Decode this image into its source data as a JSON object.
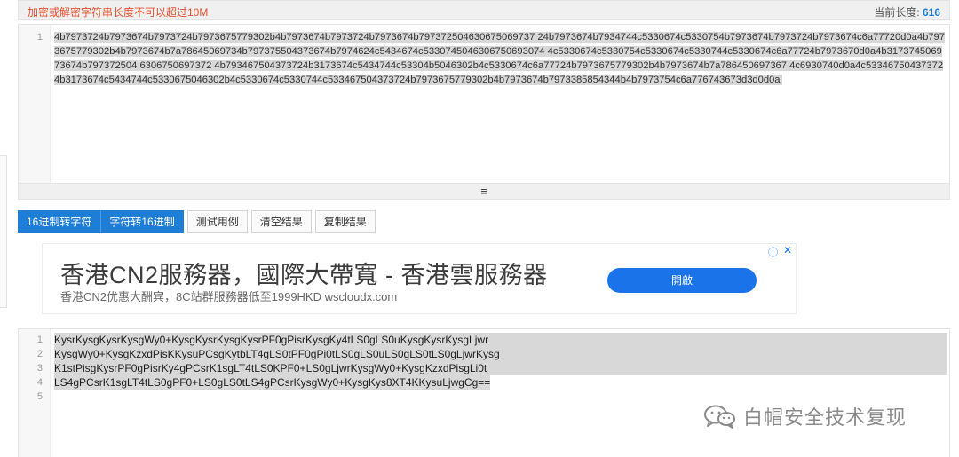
{
  "header": {
    "warning": "加密或解密字符串长度不可以超过10M",
    "length_label": "当前长度:",
    "length_value": "616"
  },
  "input_editor": {
    "line_numbers": [
      "1"
    ],
    "text": "4b7973724b7973674b7973724b7973675779302b4b7973674b7973724b7973674b797372504630675069737 24b7973674b7934744c5330674c5330754b7973674b7973724b7973674c6a77720d0a4b7973675779302b4b7973674b7a78645069734b797375504373674b7974624c5434674c5330745046306750693074 4c5330674c5330754c5330674c5330744c5330674c6a77724b7973670d0a4b317374506973674b797372504 6306750697372 4b793467504373724b3173674c5434744c53304b5046302b4c5330674c6a77724b7973675779302b4b7973674b7a786450697367 4c6930740d0a4c533467504373724b3173674c5434744c5330675046302b4c5330674c5330744c533467504373724b7973675779302b4b7973674b7973385854344b4b7973754c6a776743673d3d0d0a"
  },
  "resize_handle": "≡",
  "toolbar": {
    "hex_to_str": "16进制转字符",
    "str_to_hex": "字符转16进制",
    "test_case": "测试用例",
    "clear": "清空结果",
    "copy": "复制结果"
  },
  "ad": {
    "title": "香港CN2服務器，國際大帶寬 - 香港雲服務器",
    "subtitle": "香港CN2优惠大酬宾，8C站群服務器低至1999HKD wscloudx.com",
    "cta": "開啟",
    "info": "ⓘ",
    "close": "✕"
  },
  "output_editor": {
    "line_numbers": [
      "1",
      "2",
      "3",
      "4",
      "5"
    ],
    "lines": [
      "KysrKysgKysrKysgWy0+KysgKysrKysgKysrPF0gPisrKysgKy4tLS0gLS0uKysgKysrKysgLjwr",
      "KysgWy0+KysgKzxdPisKKysuPCsgKytbLT4gLS0tPF0gPi0tLS0gLS0uLS0gLS0tLS0gLjwrKysg",
      "K1stPisgKysrPF0gPisrKy4gPCsrK1sgLT4tLS0KPF0+LS0gLjwrKysgWy0+KysgKzxdPisgLi0t",
      "LS4gPCsrK1sgLT4tLS0gPF0+LS0gLS0tLS4gPCsrKysgWy0+KysgKys8XT4KKysuLjwgCg==",
      ""
    ]
  },
  "watermark": {
    "text": "白帽安全技术复现",
    "icon": "wechat-icon"
  }
}
